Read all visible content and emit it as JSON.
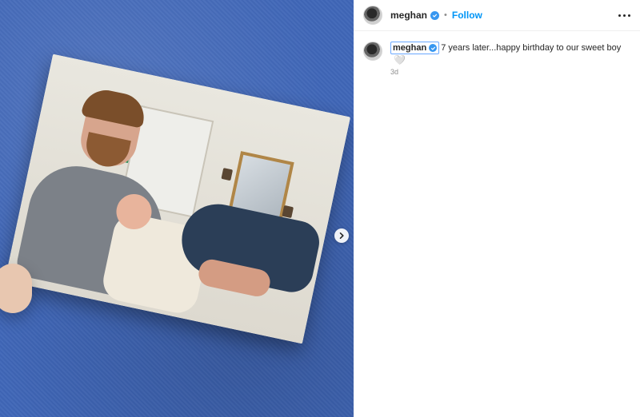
{
  "post": {
    "username": "meghan",
    "follow_label": "Follow",
    "separator": "•",
    "caption_text": "7 years later...happy birthday to our sweet boy",
    "caption_emoji": "🤍",
    "time_ago": "3d"
  },
  "icons": {
    "verified": "verified-badge-icon",
    "more": "more-options-icon",
    "next": "chevron-right-icon"
  },
  "colors": {
    "follow": "#0095f6",
    "verified": "#3897f0",
    "media_bg": "#3f66b7"
  }
}
